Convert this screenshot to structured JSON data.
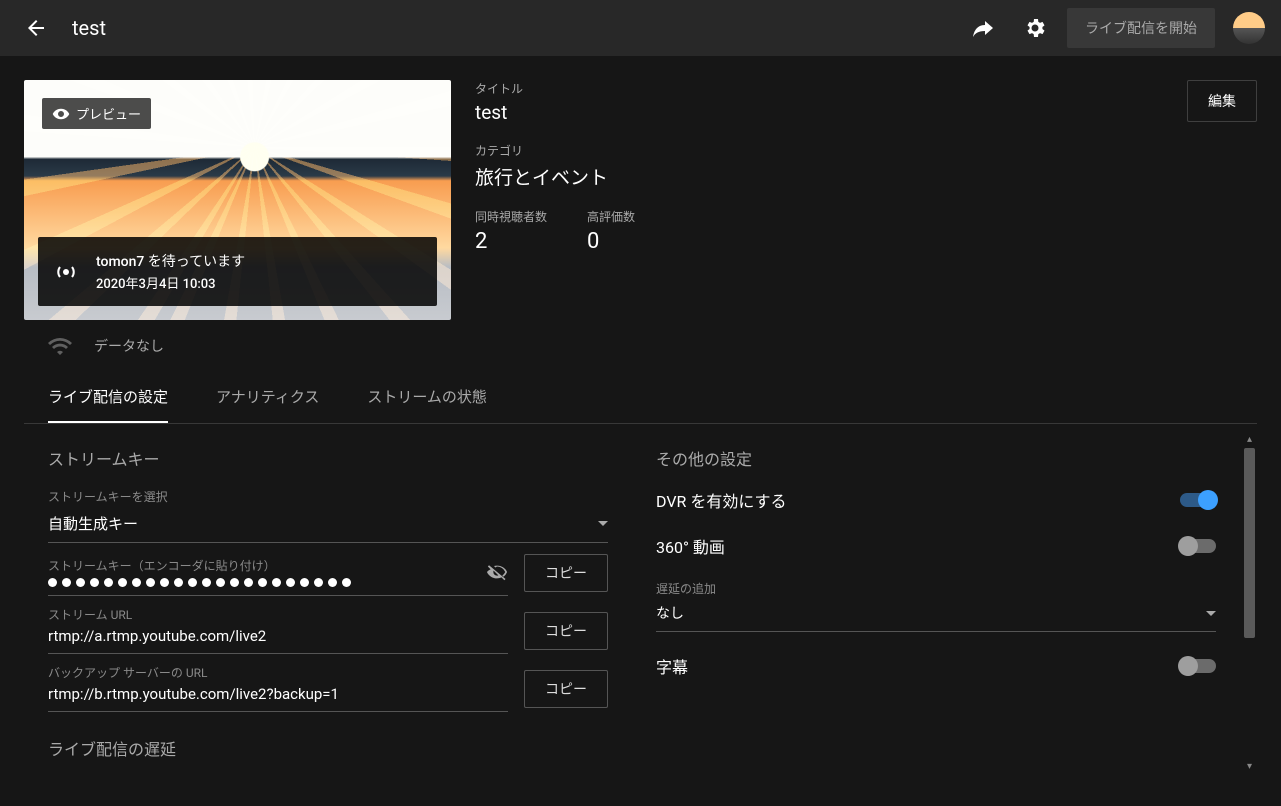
{
  "header": {
    "title": "test",
    "start_button": "ライブ配信を開始"
  },
  "preview": {
    "badge": "プレビュー",
    "wait_line": "tomon7 を待っています",
    "wait_time": "2020年3月4日 10:03"
  },
  "meta": {
    "title_label": "タイトル",
    "title_value": "test",
    "category_label": "カテゴリ",
    "category_value": "旅行とイベント",
    "viewers_label": "同時視聴者数",
    "viewers_value": "2",
    "likes_label": "高評価数",
    "likes_value": "0",
    "edit_button": "編集"
  },
  "status": {
    "text": "データなし"
  },
  "tabs": {
    "t0": "ライブ配信の設定",
    "t1": "アナリティクス",
    "t2": "ストリームの状態"
  },
  "stream": {
    "section": "ストリームキー",
    "select_label": "ストリームキーを選択",
    "select_value": "自動生成キー",
    "key_label": "ストリームキー（エンコーダに貼り付け）",
    "url_label": "ストリーム URL",
    "url_value": "rtmp://a.rtmp.youtube.com/live2",
    "backup_label": "バックアップ サーバーの URL",
    "backup_value": "rtmp://b.rtmp.youtube.com/live2?backup=1",
    "copy": "コピー",
    "latency_section": "ライブ配信の遅延"
  },
  "other": {
    "section": "その他の設定",
    "dvr": "DVR を有効にする",
    "v360": "360° 動画",
    "delay_label": "遅延の追加",
    "delay_value": "なし",
    "subtitles": "字幕"
  }
}
